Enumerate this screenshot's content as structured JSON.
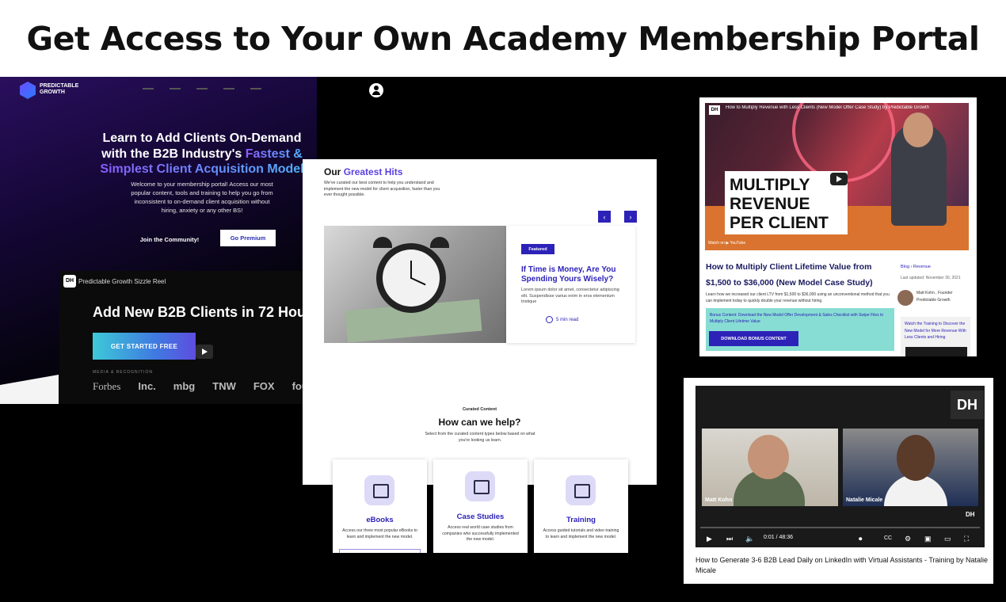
{
  "headline": "Get Access to Your Own Academy Membership Portal",
  "portal": {
    "logo_name": "PREDICTABLE GROWTH",
    "hero_title_line1": "Learn to Add Clients On-Demand",
    "hero_title_line2": "with the B2B Industry's",
    "hero_title_highlight": "Fastest &",
    "hero_title_line3": "Simplest Client Acquisition Model",
    "hero_body": "Welcome to your membership portal! Access our most popular content, tools and training to help you go from inconsistent to on-demand client acquisition without hiring, anxiety or any other BS!",
    "community_button": "Join the Community!",
    "premium_button": "Go Premium",
    "sizzle_badge": "DH",
    "sizzle_label": "Predictable Growth Sizzle Reel",
    "sizzle_headline": "Add New B2B Clients in 72 Hou",
    "get_started_button": "GET STARTED FREE",
    "media_label": "MEDIA & RECOGNITION",
    "media_logos": [
      "Forbes",
      "Inc.",
      "mbg",
      "TNW",
      "FOX",
      "four"
    ]
  },
  "center": {
    "hits_title": "Our",
    "hits_title_accent": "Greatest Hits",
    "hits_sub": "We've curated our best content to help you understand and implement the new model for client acquisition, faster than you ever thought possible.",
    "prev_arrow": "‹",
    "next_arrow": "›",
    "featured_tag": "Featured",
    "featured_title": "If Time is Money, Are You Spending Yours Wisely?",
    "featured_body": "Lorem ipsum dolor sit amet, consectetur adipiscing elit. Suspendisse varius enim in eros elementum tristique",
    "read_time": "5 min read",
    "curated_kicker": "Curated Content",
    "curated_title": "How can we help?",
    "curated_sub": "Select from the curated content types below based on what you're looking us learn.",
    "types": [
      {
        "title": "eBooks",
        "body": "Access our three most popular eBooks to learn and implement the new model."
      },
      {
        "title": "Case Studies",
        "body": "Access real world case studies from companies who successfully implemented the new model."
      },
      {
        "title": "Training",
        "body": "Access guided tutorials and video training to learn and implement the new model."
      }
    ]
  },
  "right_top": {
    "dh": "DH",
    "video_title": "How to Multiply Revenue with Less Clients (New Model Offer Case Study) by Predictable Growth",
    "overlay_text": "MULTIPLY REVENUE PER CLIENT",
    "watch_on": "Watch on ▶ YouTube",
    "article_title": "How to Multiply Client Lifetime Value from $1,500 to $36,000 (New Model Case Study)",
    "article_body": "Learn how we increased our client LTV from $1,500 to $36,000 using an unconventional method that you can implement today to quickly double your revenue without hiring.",
    "blog_tag": "Blog › Revenue",
    "updated": "Last updated: November 30, 2021",
    "author": "Matt Kohn , Founder Predictable Growth",
    "bonus_text": "Bonus Content: Download the New Model Offer Development & Sales Checklist with Swipe Files to Multiply Client Lifetime Value",
    "bonus_button": "DOWNLOAD BONUS CONTENT",
    "side_card_text": "Watch the Training to Discover the New Model for More Revenue With Less Clients and Hiring"
  },
  "right_bottom": {
    "dh_corner": "DH",
    "left_name": "Matt Kohn",
    "right_name": "Natalie Micale",
    "dh_mini": "DH",
    "time": "0:01 / 48:36",
    "title": "How to Generate 3-6 B2B Lead Daily on LinkedIn with Virtual Assistants - Training by Natalie Micale",
    "icons": [
      "play-icon",
      "next-icon",
      "volume-icon",
      "autoplay-toggle",
      "captions-icon",
      "settings-icon",
      "miniplayer-icon",
      "theater-icon",
      "fullscreen-icon"
    ]
  },
  "colors": {
    "brand_blue": "#2d22b8",
    "accent_purple": "#5b3fe0",
    "bonus_teal": "#87ddd3"
  }
}
